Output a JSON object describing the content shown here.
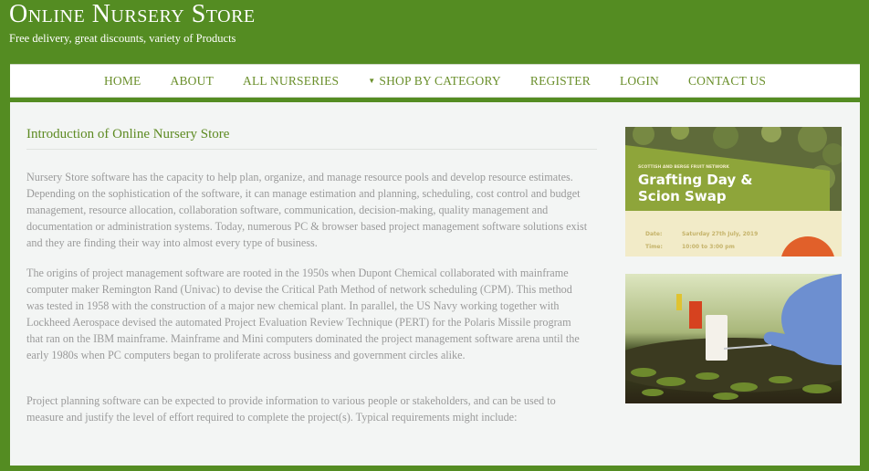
{
  "header": {
    "title": "Online Nursery Store",
    "tagline": "Free delivery, great discounts, variety of Products"
  },
  "nav": {
    "items": [
      {
        "label": "HOME"
      },
      {
        "label": "ABOUT"
      },
      {
        "label": "ALL NURSERIES"
      },
      {
        "label": "SHOP BY CATEGORY",
        "has_dropdown": true,
        "caret_icon": "caret-down-icon"
      },
      {
        "label": "REGISTER"
      },
      {
        "label": "LOGIN"
      },
      {
        "label": "CONTACT US"
      }
    ]
  },
  "main": {
    "title": "Introduction of Online Nursery Store",
    "paragraphs": [
      "Nursery Store software has the capacity to help plan, organize, and manage resource pools and develop resource estimates. Depending on the sophistication of the software, it can manage estimation and planning, scheduling, cost control and budget management, resource allocation, collaboration software, communication, decision-making, quality management and documentation or administration systems. Today, numerous PC & browser based project management software solutions exist and they are finding their way into almost every type of business.",
      "The origins of project management software are rooted in the 1950s when Dupont Chemical collaborated with mainframe computer maker Remington Rand (Univac) to devise the Critical Path Method of network scheduling (CPM). This method was tested in 1958 with the construction of a major new chemical plant. In parallel, the US Navy working together with Lockheed Aerospace devised the automated Project Evaluation Review Technique (PERT) for the Polaris Missile program that ran on the IBM mainframe. Mainframe and Mini computers dominated the project management software arena until the early 1980s when PC computers began to proliferate across business and government circles alike.",
      "Project planning software can be expected to provide information to various people or stakeholders, and can be used to measure and justify the level of effort required to complete the project(s). Typical requirements might include:"
    ]
  },
  "sidebar": {
    "event_banner": {
      "kicker": "SCOTTISH AND BERGE FRUIT NETWORK",
      "title_line1": "Grafting Day &",
      "title_line2": "Scion Swap",
      "date_label": "Date:",
      "date_value": "Saturday 27th July, 2019",
      "time_label": "Time:",
      "time_value": "10:00 to 3:00 pm"
    },
    "grafting_photo": {
      "icon": "gloved-hand-grafting-seedling-photo"
    }
  },
  "colors": {
    "page_green": "#548c22",
    "nav_text": "#6a8f2b",
    "title_green": "#5d8a22",
    "body_text": "#9a9a9a",
    "banner_olive": "#8ea53a",
    "banner_cream": "#f2ebc8",
    "banner_orange": "#e1602a"
  }
}
